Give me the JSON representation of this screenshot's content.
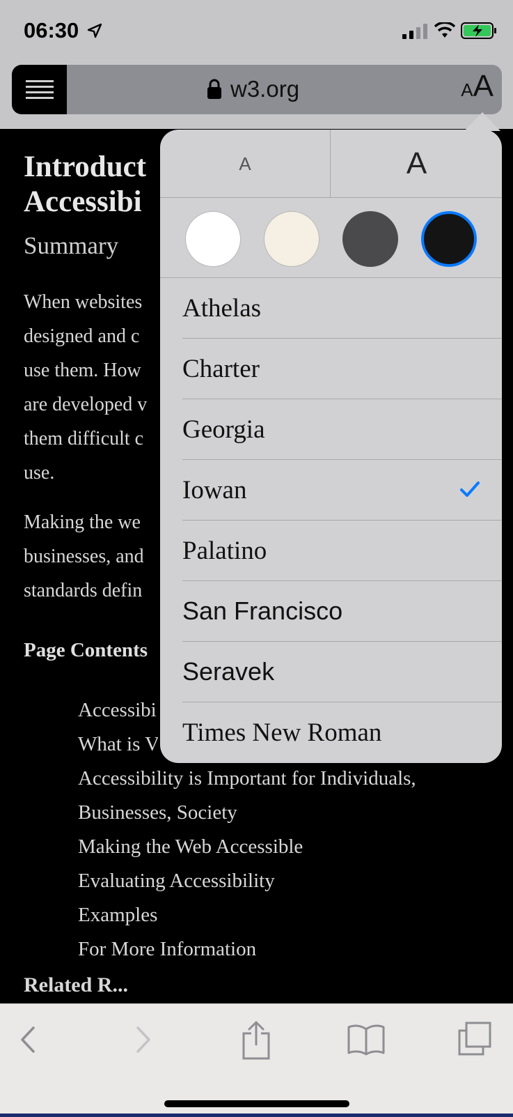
{
  "status_bar": {
    "time": "06:30"
  },
  "address_bar": {
    "url": "w3.org",
    "text_size_small": "A",
    "text_size_large": "A"
  },
  "article": {
    "title_line1": "Introduct",
    "title_line2": "Accessibi",
    "summary": "Summary",
    "para1": [
      "When websites",
      "designed and c",
      "use them. How",
      "are developed v",
      "them difficult c",
      "use."
    ],
    "para2": [
      "Making the we",
      "businesses, and",
      "standards defin"
    ],
    "contents_heading": "Page Contents",
    "toc": [
      "Accessibi",
      "What is V",
      "Accessibility is Important for Individuals, Businesses, Society",
      "Making the Web Accessible",
      "Evaluating Accessibility",
      "Examples",
      "For More Information"
    ],
    "related_partial": "Related R..."
  },
  "popover": {
    "size_small": "A",
    "size_large": "A",
    "themes": [
      "white",
      "sepia",
      "gray",
      "black"
    ],
    "selected_theme": "black",
    "fonts": [
      "Athelas",
      "Charter",
      "Georgia",
      "Iowan",
      "Palatino",
      "San Francisco",
      "Seravek",
      "Times New Roman"
    ],
    "selected_font": "Iowan"
  },
  "colors": {
    "accent": "#0a7aff",
    "popover_bg": "#d1d1d3",
    "page_bg": "#000000"
  }
}
